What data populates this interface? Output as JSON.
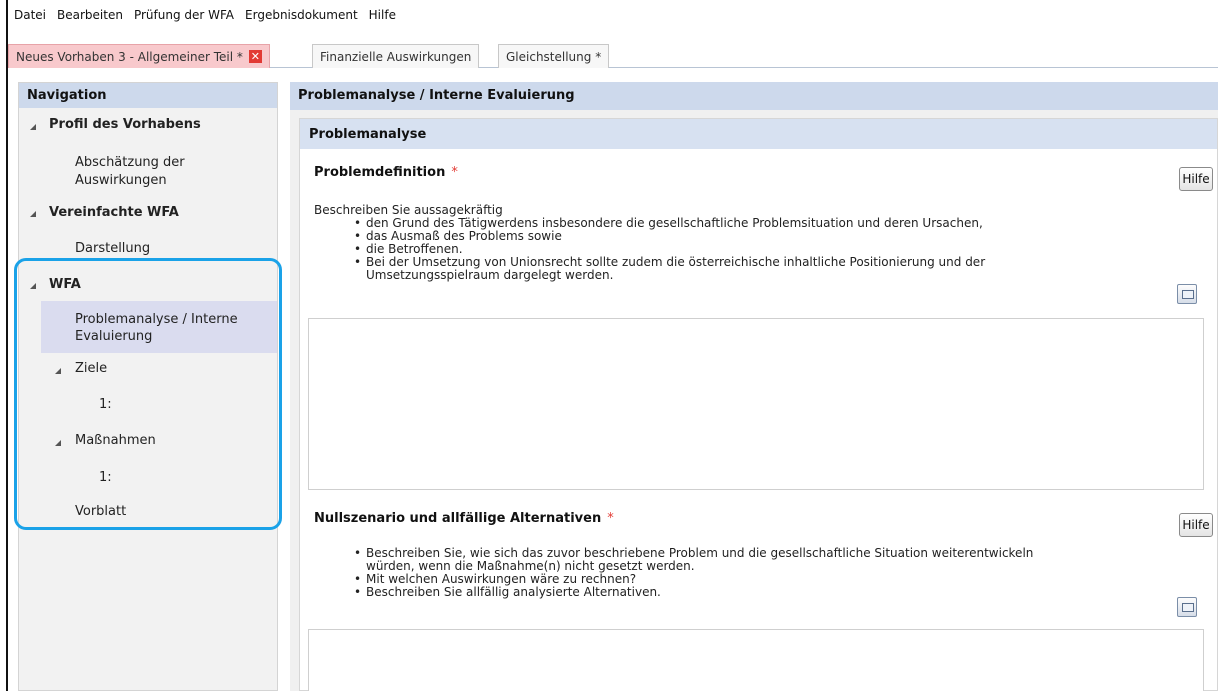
{
  "menubar": {
    "items": [
      "Datei",
      "Bearbeiten",
      "Prüfung der WFA",
      "Ergebnisdokument",
      "Hilfe"
    ]
  },
  "tabs": [
    {
      "label": "Neues Vorhaben 3 - Allgemeiner Teil *",
      "active": true,
      "close": "✕"
    },
    {
      "label": "Finanzielle Auswirkungen",
      "active": false
    },
    {
      "label": "Gleichstellung *",
      "active": false
    }
  ],
  "nav": {
    "title": "Navigation",
    "items": {
      "profil": "Profil des Vorhabens",
      "abschaetzung_1": "Abschätzung der",
      "abschaetzung_2": "Auswirkungen",
      "vereinfachte": "Vereinfachte WFA",
      "darstellung": "Darstellung",
      "wfa": "WFA",
      "problemanalyse_1": "Problemanalyse / Interne",
      "problemanalyse_2": "Evaluierung",
      "ziele": "Ziele",
      "ziele_1": "1:",
      "massnahmen": "Maßnahmen",
      "massnahmen_1": "1:",
      "vorblatt": "Vorblatt"
    }
  },
  "main": {
    "title": "Problemanalyse / Interne Evaluierung",
    "section_title": "Problemanalyse",
    "fields": {
      "problemdefinition": {
        "label": "Problemdefinition",
        "required": "*",
        "help": "Hilfe",
        "intro": "Beschreiben Sie aussagekräftig",
        "bullets": [
          "den Grund des Tätigwerdens insbesondere die gesellschaftliche Problemsituation und deren Ursachen,",
          "das Ausmaß des Problems sowie",
          "die Betroffenen.",
          "Bei der Umsetzung von Unionsrecht sollte zudem die österreichische inhaltliche Positionierung und der",
          "Umsetzungsspielraum dargelegt werden."
        ],
        "value": ""
      },
      "nullszenario": {
        "label": "Nullszenario und allfällige Alternativen",
        "required": "*",
        "help": "Hilfe",
        "bullets": [
          "Beschreiben Sie, wie sich das zuvor beschriebene Problem und die gesellschaftliche Situation weiterentwickeln",
          "würden, wenn die Maßnahme(n) nicht gesetzt werden.",
          "Mit welchen Auswirkungen wäre zu rechnen?",
          "Beschreiben Sie allfällig analysierte Alternativen."
        ],
        "value": ""
      }
    }
  },
  "colors": {
    "header_bg": "#cdd9ec",
    "active_tab": "#f8c9cc",
    "highlight": "#1aa2e8",
    "required": "#e23a34"
  }
}
